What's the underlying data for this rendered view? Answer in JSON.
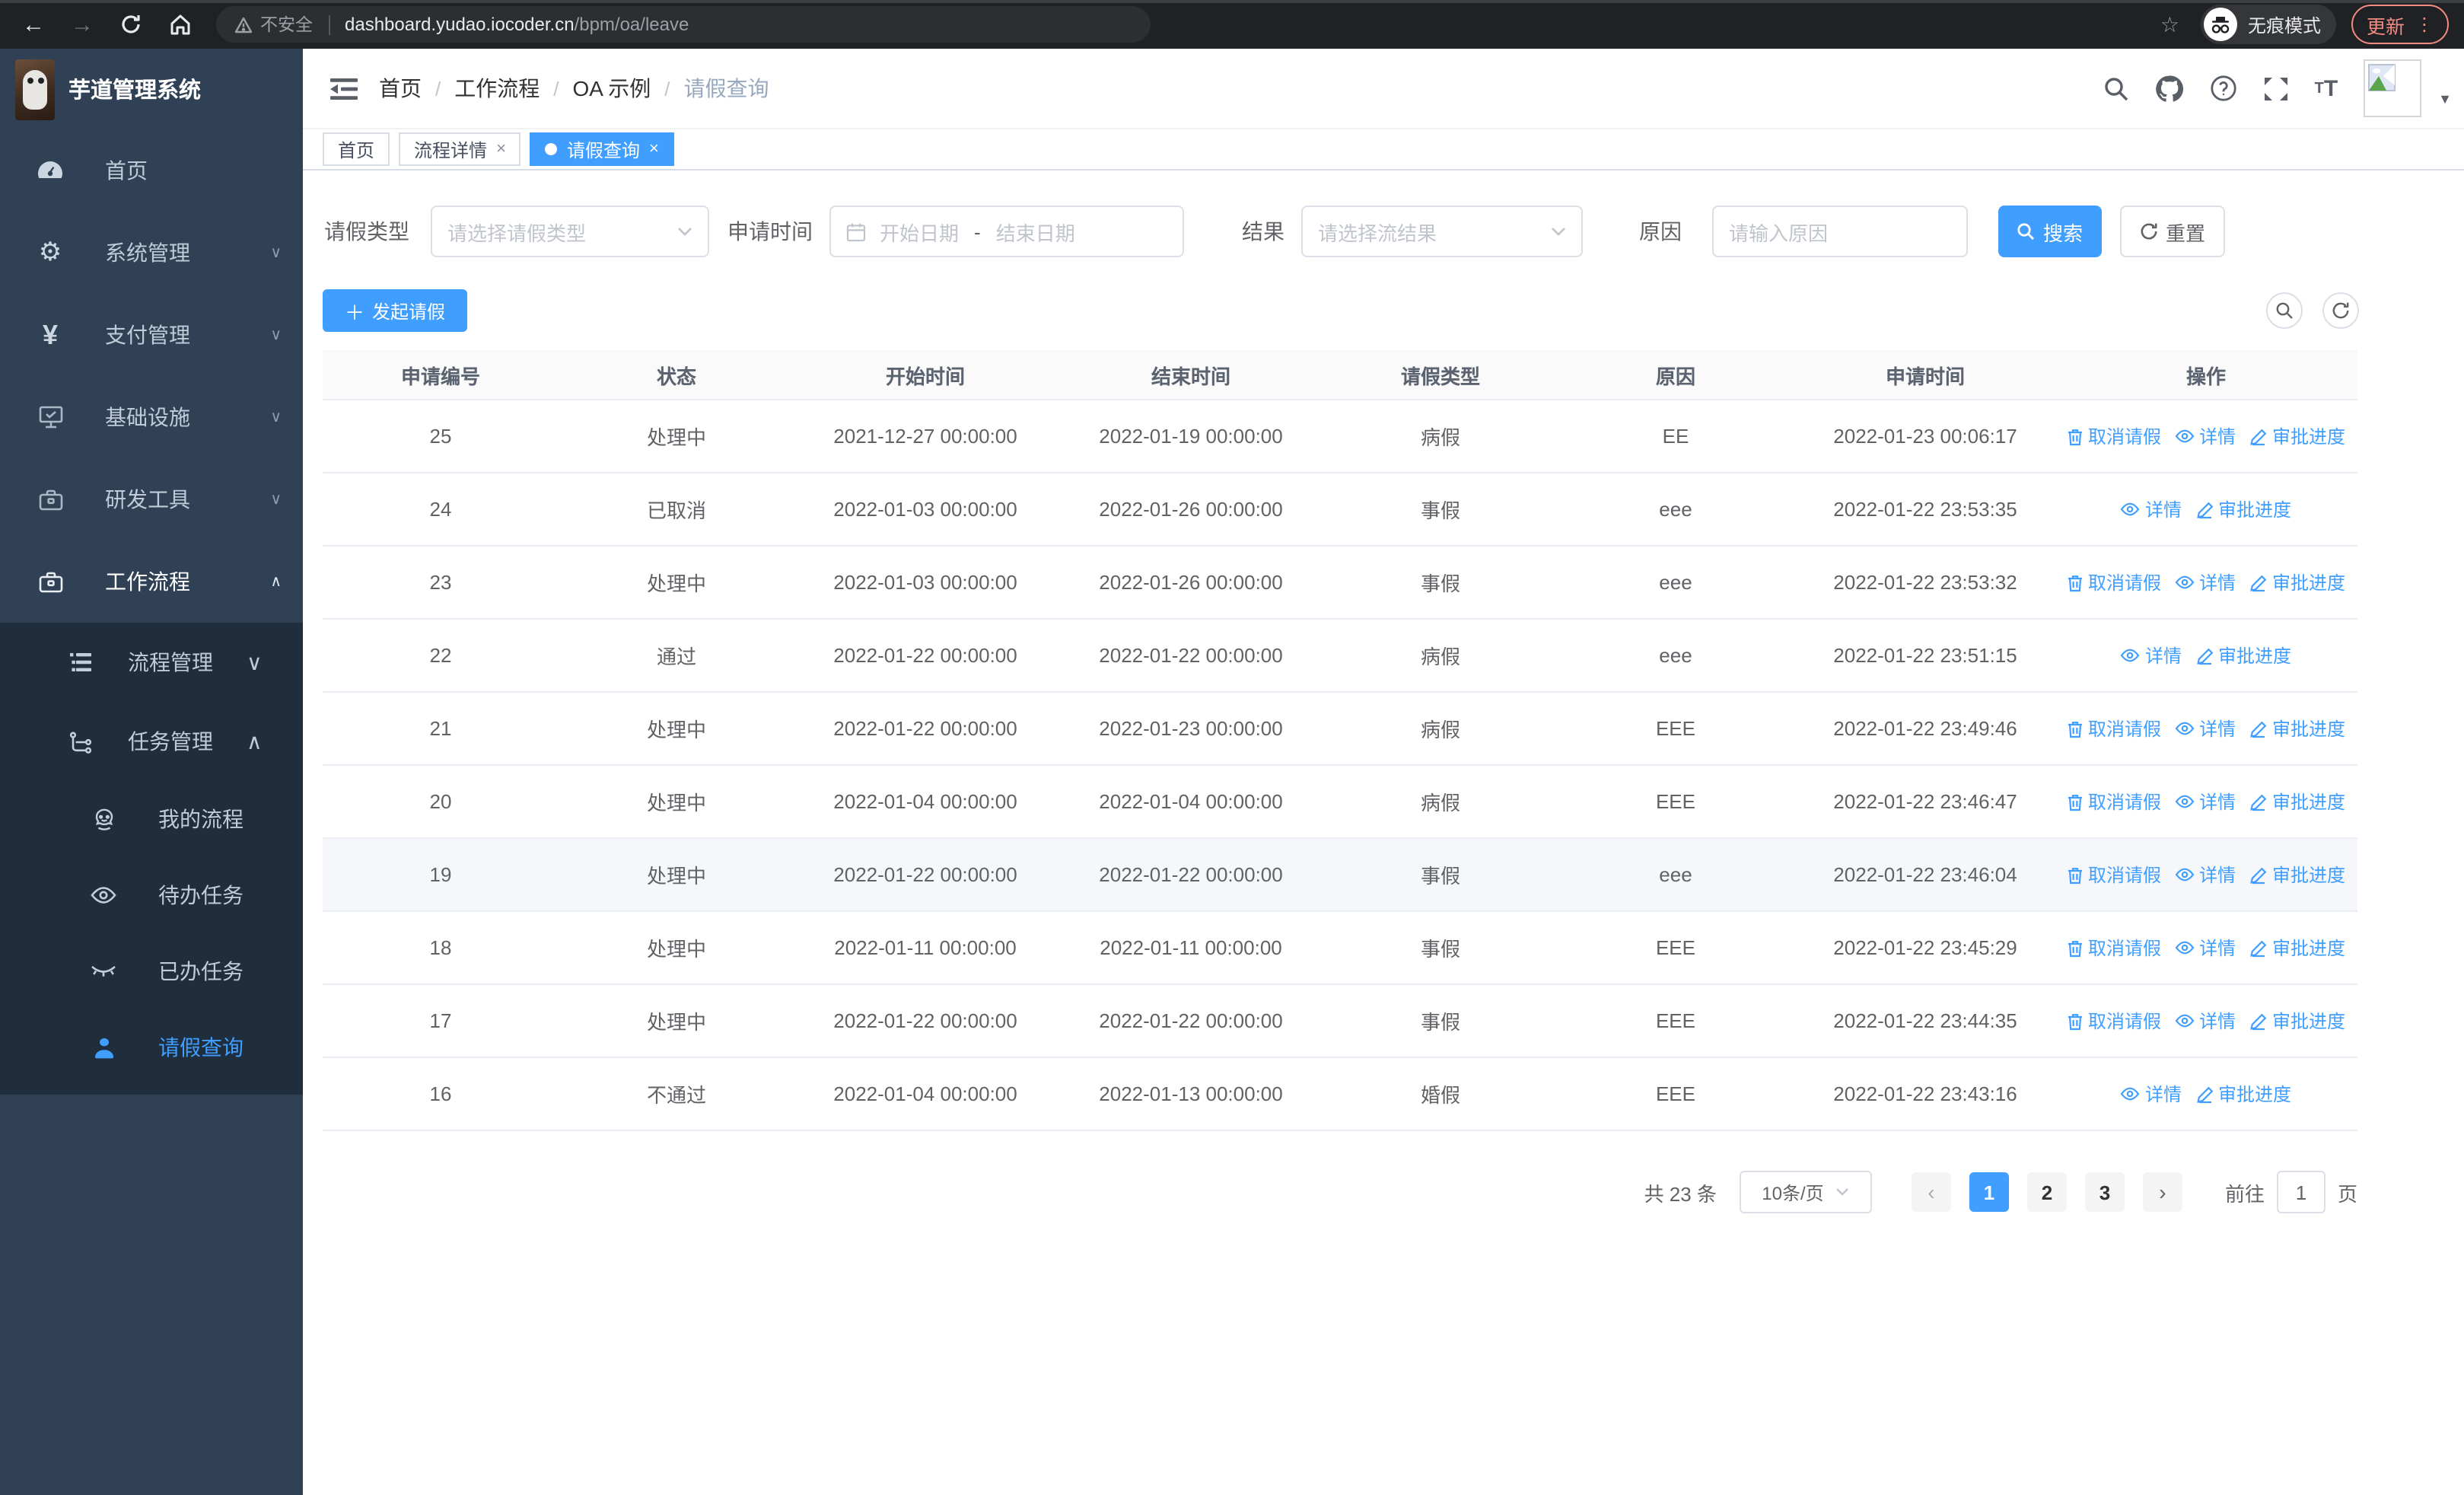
{
  "colors": {
    "primary": "#409eff",
    "sidebar_bg": "#304156",
    "submenu_bg": "#1f2d3d",
    "sidebar_text": "#bfcbd9",
    "browser_bar_bg": "#202124",
    "update_accent": "#f28b82",
    "table_border": "#ebeef5",
    "highlight_row_bg": "#f5f7fa"
  },
  "browser": {
    "security_chip": "不安全",
    "url_host": "dashboard.yudao.iocoder.cn",
    "url_path": "/bpm/oa/leave",
    "incognito_label": "无痕模式",
    "update_button": "更新"
  },
  "sidebar": {
    "title": "芋道管理系统",
    "menu": [
      {
        "label": "首页",
        "icon": "dashboard-icon"
      },
      {
        "label": "系统管理",
        "icon": "gear-icon"
      },
      {
        "label": "支付管理",
        "icon": "yen-icon"
      },
      {
        "label": "基础设施",
        "icon": "monitor-icon"
      },
      {
        "label": "研发工具",
        "icon": "toolbox-icon"
      },
      {
        "label": "工作流程",
        "icon": "briefcase-icon",
        "expanded": true
      }
    ],
    "submenu": [
      {
        "label": "流程管理",
        "icon": "flow-list-icon"
      },
      {
        "label": "任务管理",
        "icon": "task-tree-icon",
        "expanded": true
      }
    ],
    "task_children": [
      {
        "label": "我的流程",
        "icon": "face-icon"
      },
      {
        "label": "待办任务",
        "icon": "eye-open-icon"
      },
      {
        "label": "已办任务",
        "icon": "eye-closed-icon"
      },
      {
        "label": "请假查询",
        "icon": "user-icon",
        "active": true
      }
    ]
  },
  "header": {
    "breadcrumb": [
      "首页",
      "工作流程",
      "OA 示例",
      "请假查询"
    ],
    "font_icon_text": "tT"
  },
  "tabs": [
    {
      "label": "首页"
    },
    {
      "label": "流程详情",
      "closable": true
    },
    {
      "label": "请假查询",
      "closable": true,
      "active": true
    }
  ],
  "filters": {
    "leave_type_label": "请假类型",
    "leave_type_placeholder": "请选择请假类型",
    "apply_time_label": "申请时间",
    "start_date_placeholder": "开始日期",
    "date_separator": "-",
    "end_date_placeholder": "结束日期",
    "result_label": "结果",
    "result_placeholder": "请选择流结果",
    "reason_label": "原因",
    "reason_placeholder": "请输入原因",
    "search_button": "搜索",
    "reset_button": "重置"
  },
  "toolbar": {
    "create_button": "发起请假"
  },
  "table": {
    "headers": [
      "申请编号",
      "状态",
      "开始时间",
      "结束时间",
      "请假类型",
      "原因",
      "申请时间",
      "操作"
    ],
    "action_labels": {
      "cancel": "取消请假",
      "detail": "详情",
      "progress": "审批进度"
    },
    "rows": [
      {
        "id": "25",
        "status": "处理中",
        "start": "2021-12-27 00:00:00",
        "end": "2022-01-19 00:00:00",
        "type": "病假",
        "reason": "EE",
        "applied": "2022-01-23 00:06:17",
        "cancellable": true
      },
      {
        "id": "24",
        "status": "已取消",
        "start": "2022-01-03 00:00:00",
        "end": "2022-01-26 00:00:00",
        "type": "事假",
        "reason": "eee",
        "applied": "2022-01-22 23:53:35",
        "cancellable": false
      },
      {
        "id": "23",
        "status": "处理中",
        "start": "2022-01-03 00:00:00",
        "end": "2022-01-26 00:00:00",
        "type": "事假",
        "reason": "eee",
        "applied": "2022-01-22 23:53:32",
        "cancellable": true
      },
      {
        "id": "22",
        "status": "通过",
        "start": "2022-01-22 00:00:00",
        "end": "2022-01-22 00:00:00",
        "type": "病假",
        "reason": "eee",
        "applied": "2022-01-22 23:51:15",
        "cancellable": false
      },
      {
        "id": "21",
        "status": "处理中",
        "start": "2022-01-22 00:00:00",
        "end": "2022-01-23 00:00:00",
        "type": "病假",
        "reason": "EEE",
        "applied": "2022-01-22 23:49:46",
        "cancellable": true
      },
      {
        "id": "20",
        "status": "处理中",
        "start": "2022-01-04 00:00:00",
        "end": "2022-01-04 00:00:00",
        "type": "病假",
        "reason": "EEE",
        "applied": "2022-01-22 23:46:47",
        "cancellable": true
      },
      {
        "id": "19",
        "status": "处理中",
        "start": "2022-01-22 00:00:00",
        "end": "2022-01-22 00:00:00",
        "type": "事假",
        "reason": "eee",
        "applied": "2022-01-22 23:46:04",
        "cancellable": true,
        "highlighted": true
      },
      {
        "id": "18",
        "status": "处理中",
        "start": "2022-01-11 00:00:00",
        "end": "2022-01-11 00:00:00",
        "type": "事假",
        "reason": "EEE",
        "applied": "2022-01-22 23:45:29",
        "cancellable": true
      },
      {
        "id": "17",
        "status": "处理中",
        "start": "2022-01-22 00:00:00",
        "end": "2022-01-22 00:00:00",
        "type": "事假",
        "reason": "EEE",
        "applied": "2022-01-22 23:44:35",
        "cancellable": true
      },
      {
        "id": "16",
        "status": "不通过",
        "start": "2022-01-04 00:00:00",
        "end": "2022-01-13 00:00:00",
        "type": "婚假",
        "reason": "EEE",
        "applied": "2022-01-22 23:43:16",
        "cancellable": false
      }
    ]
  },
  "pagination": {
    "total_text": "共 23 条",
    "page_size": "10条/页",
    "prev_icon": "‹",
    "next_icon": "›",
    "pages": [
      "1",
      "2",
      "3"
    ],
    "active_page": "1",
    "goto_label": "前往",
    "goto_value": "1",
    "page_unit": "页"
  }
}
